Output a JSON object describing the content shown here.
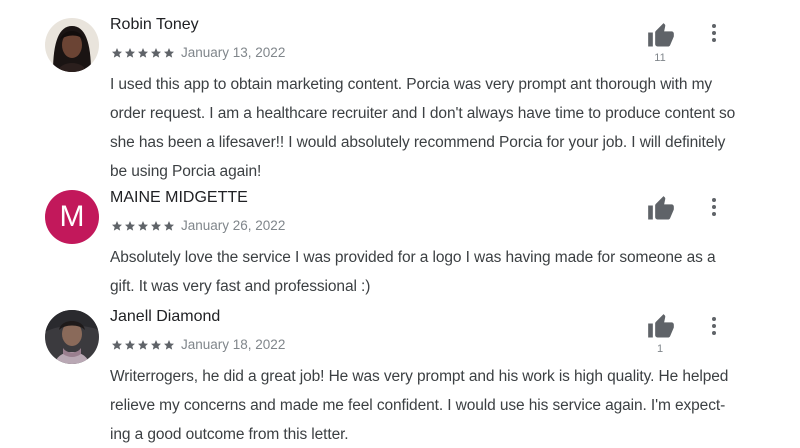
{
  "colors": {
    "star": "#5f6368",
    "icon": "#5f6368",
    "avatar_m_bg": "#c2185b"
  },
  "reviews": [
    {
      "author": "Robin Toney",
      "rating": 5,
      "date": "January 13, 2022",
      "helpful_count": "11",
      "avatar": "photo",
      "text_lines": [
        "I used this app to obtain marketing content. Porcia was very prompt ant thorough with my",
        "order request. I am a healthcare recruiter and I don't always have time to produce content so",
        "she has been a lifesaver!! I would absolutely recommend Porcia for your job. I will definitely",
        "be using Porcia again!"
      ]
    },
    {
      "author": "MAINE MIDGETTE",
      "rating": 5,
      "date": "January 26, 2022",
      "helpful_count": "",
      "avatar_letter": "M",
      "text_lines": [
        "Absolutely love the service I was provided for a logo I was having made for someone as a",
        "gift. It was very fast and professional :)"
      ]
    },
    {
      "author": "Janell Diamond",
      "rating": 5,
      "date": "January 18, 2022",
      "helpful_count": "1",
      "avatar": "photo",
      "text_lines": [
        "Writerrogers, he did a great job! He was very prompt and his work is high quality. He helped",
        "relieve my concerns and made me feel confident. I would use his service again. I'm expect-",
        "ing a good outcome from this letter."
      ]
    }
  ]
}
